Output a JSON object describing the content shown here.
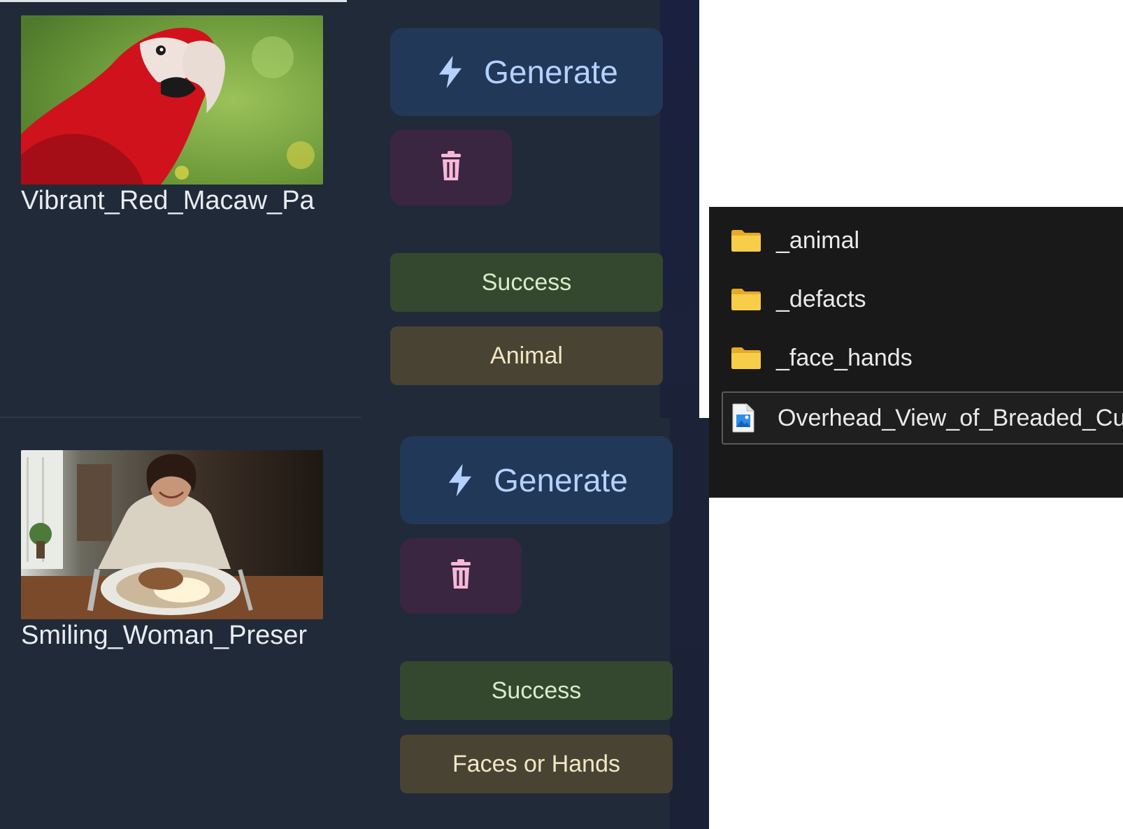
{
  "items": [
    {
      "filename": "Vibrant_Red_Macaw_Pa",
      "image_desc": "red macaw parrot photo",
      "generate_label": "Generate",
      "status_label": "Success",
      "category_label": "Animal"
    },
    {
      "filename": "Smiling_Woman_Preser",
      "image_desc": "woman with plate of food photo",
      "generate_label": "Generate",
      "status_label": "Success",
      "category_label": "Faces or Hands"
    }
  ],
  "explorer": {
    "folders": [
      "_animal",
      "_defacts",
      "_face_hands"
    ],
    "file": "Overhead_View_of_Breaded_Cutl"
  },
  "colors": {
    "panel": "#212a38",
    "generate_bg": "#223858",
    "generate_fg": "#b5d1ff",
    "delete_bg": "#3a2640",
    "delete_icon": "#f7b8d8",
    "success_bg": "#34482f",
    "category_bg": "#484333",
    "explorer_bg": "#191919",
    "folder": "#f5c542"
  },
  "icons": {
    "generate": "lightning-bolt-icon",
    "delete": "trash-icon",
    "folder": "folder-icon",
    "image_file": "image-file-icon"
  }
}
